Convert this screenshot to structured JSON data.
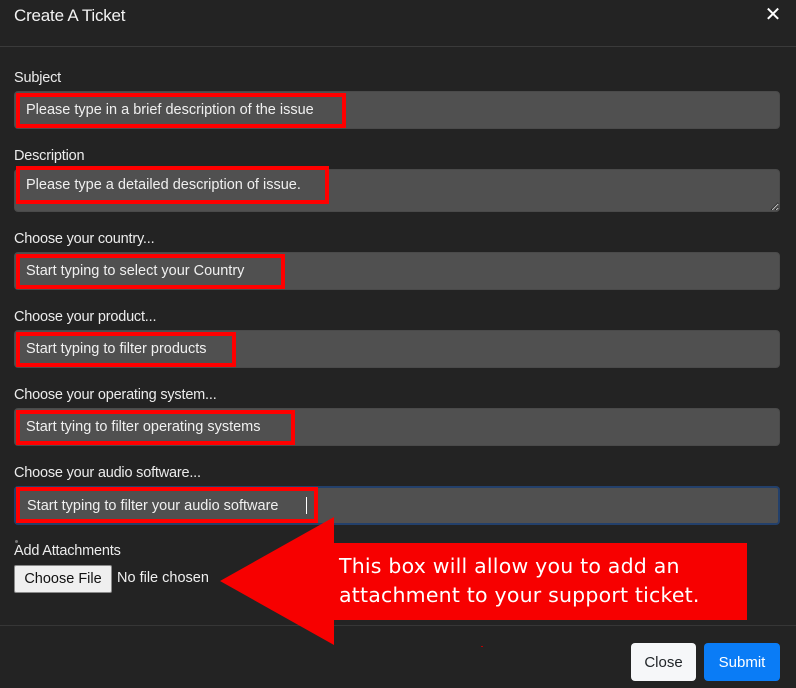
{
  "dialog": {
    "title": "Create A Ticket",
    "close_icon": "close-x-icon"
  },
  "form": {
    "subject": {
      "label": "Subject",
      "placeholder": "Please type in a brief description of the issue",
      "value": ""
    },
    "description": {
      "label": "Description",
      "placeholder": "Please type a detailed description of issue.",
      "value": ""
    },
    "country": {
      "label": "Choose your country...",
      "placeholder": "Start typing to select your Country",
      "value": ""
    },
    "product": {
      "label": "Choose your product...",
      "placeholder": "Start typing to filter products",
      "value": ""
    },
    "operating_system": {
      "label": "Choose your operating system...",
      "placeholder": "Start tying to filter operating systems",
      "value": ""
    },
    "audio_software": {
      "label": "Choose your audio software...",
      "placeholder": "Start typing to filter your audio software",
      "value": "",
      "focused": true
    },
    "attachments": {
      "label": "Add Attachments",
      "button_label": "Choose File",
      "status": "No file chosen"
    }
  },
  "footer": {
    "close_label": "Close",
    "submit_label": "Submit"
  },
  "annotation": {
    "callout_text": "This box will allow you to add an attachment to your support ticket.",
    "callout_line1": "This box will allow you to add an",
    "callout_line2": "attachment to your support ticket.",
    "highlight_color": "#ff0000",
    "arrow_color": "#f70000"
  },
  "colors": {
    "background": "#232323",
    "input_background": "#505050",
    "submit_button": "#0a7cf6",
    "close_button": "#f6f7f9",
    "focus_border": "#23406b"
  }
}
